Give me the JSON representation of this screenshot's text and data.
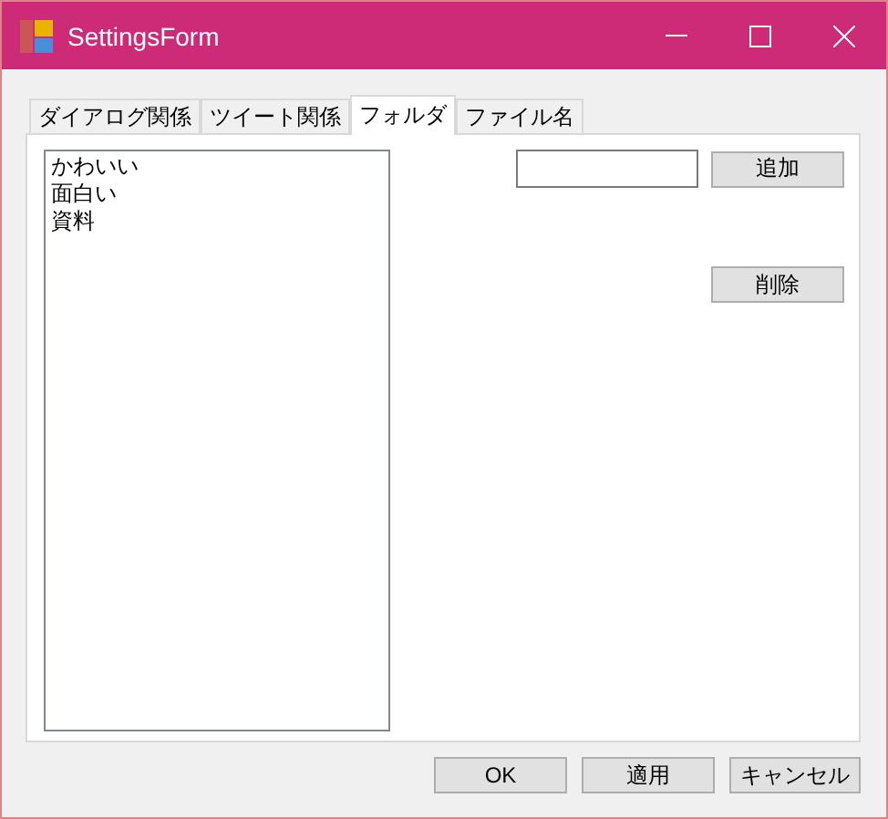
{
  "window": {
    "title": "SettingsForm"
  },
  "tabs": [
    {
      "label": "ダイアログ関係",
      "selected": false
    },
    {
      "label": "ツイート関係",
      "selected": false
    },
    {
      "label": "フォルダ",
      "selected": true
    },
    {
      "label": "ファイル名",
      "selected": false
    }
  ],
  "folder_list": {
    "items": [
      "かわいい",
      "面白い",
      "資料"
    ]
  },
  "add_button": "追加",
  "delete_button": "削除",
  "buttons": [
    "OK",
    "適用",
    "キャンセル"
  ]
}
